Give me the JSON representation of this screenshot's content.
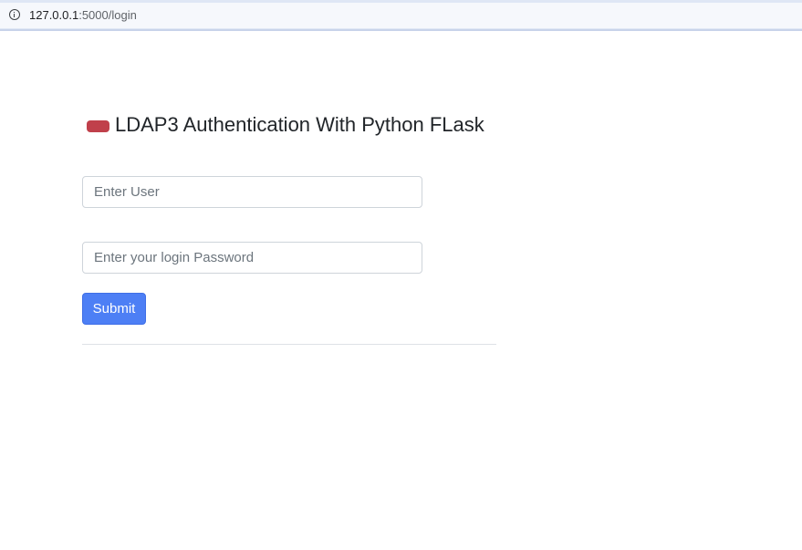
{
  "browser": {
    "url_host": "127.0.0.1",
    "url_path": ":5000/login"
  },
  "page": {
    "heading": "LDAP3 Authentication With Python FLask",
    "badge_color": "#c0404b"
  },
  "form": {
    "user_placeholder": "Enter User",
    "user_value": "",
    "password_placeholder": "Enter your login Password",
    "password_value": "",
    "submit_label": "Submit",
    "submit_color": "#4d7ff5"
  }
}
